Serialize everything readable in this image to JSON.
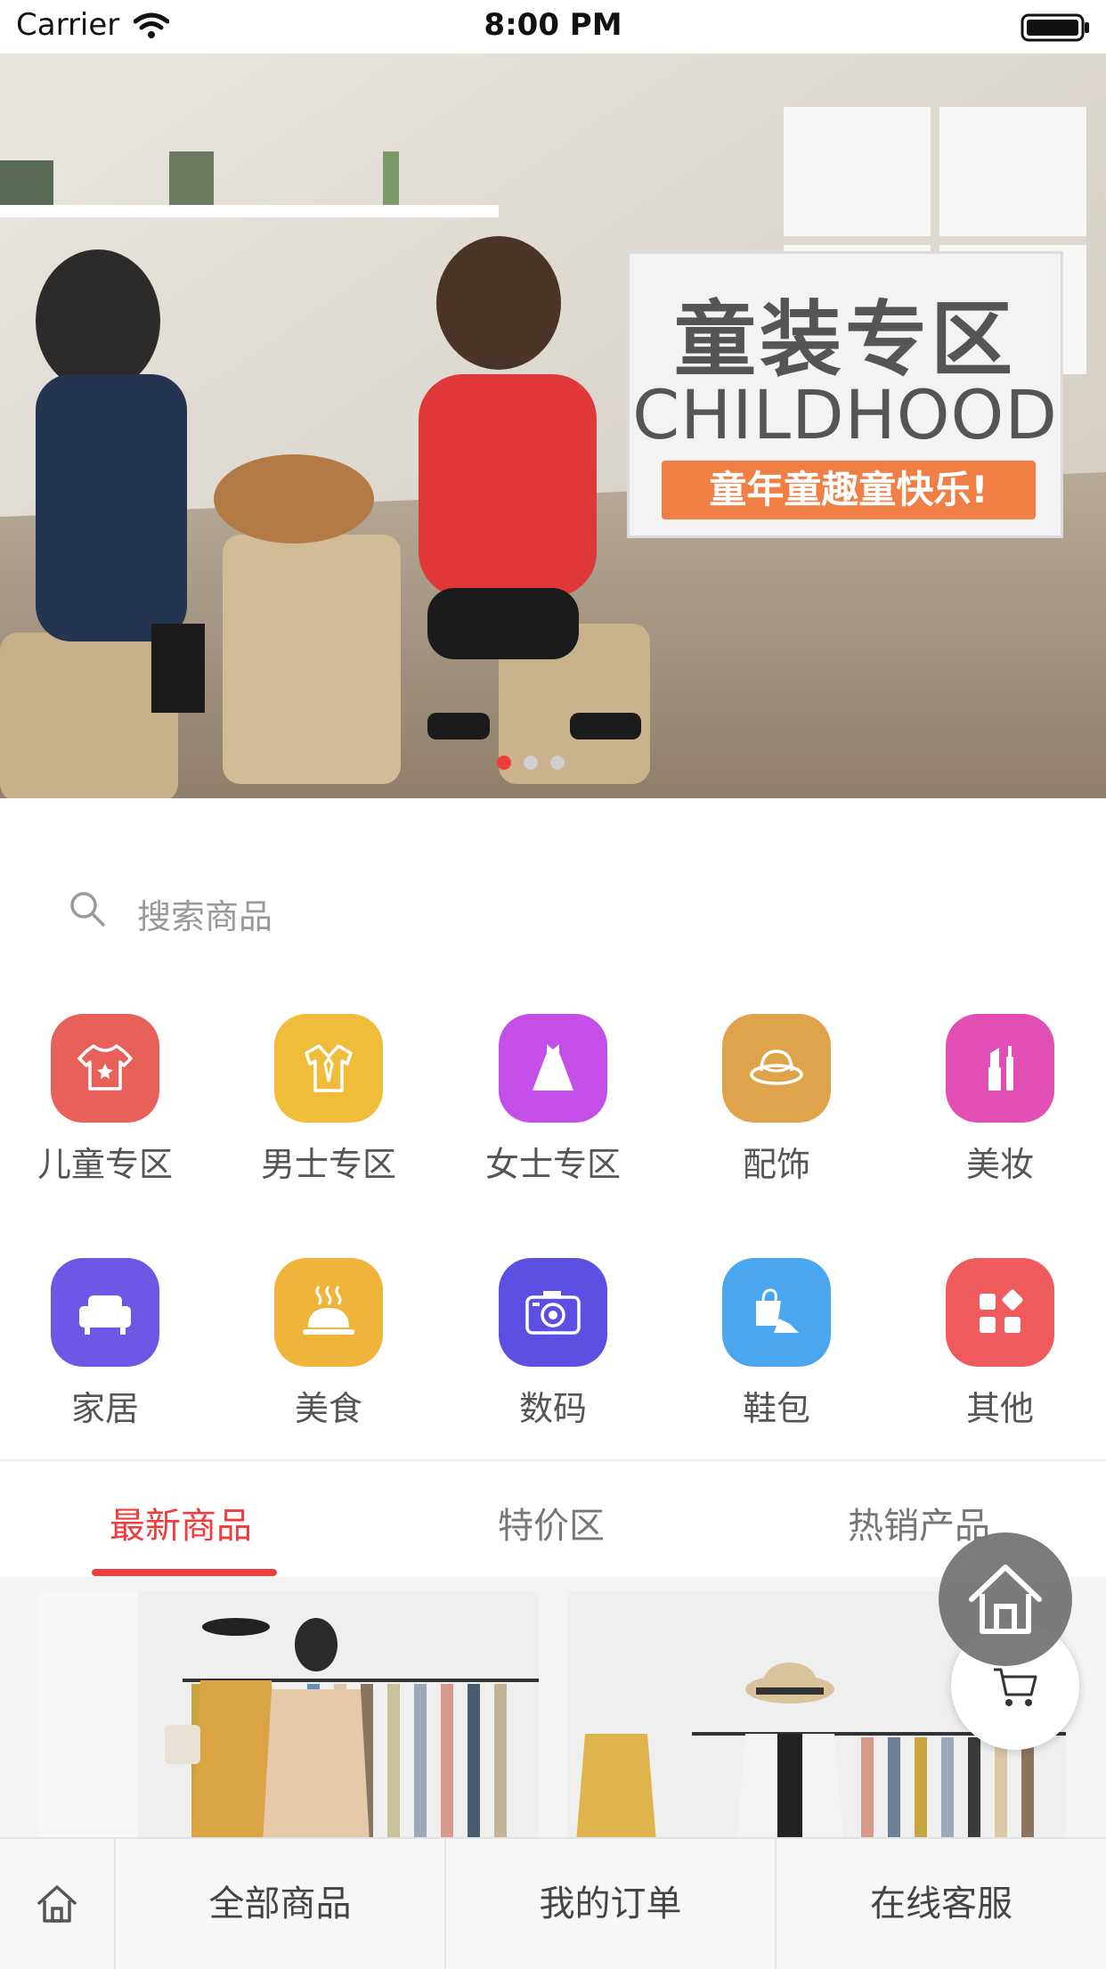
{
  "status_bar": {
    "carrier": "Carrier",
    "time": "8:00 PM"
  },
  "banner": {
    "promo_title": "童装专区",
    "promo_subtitle": "CHILDHOOD",
    "promo_tag": "童年童趣童快乐!",
    "dot_count": 3,
    "active_dot": 0,
    "colors": {
      "dot_active": "#f23c3c",
      "dot_inactive": "#cfcfcf"
    }
  },
  "search": {
    "placeholder": "搜索商品"
  },
  "categories": [
    {
      "label": "儿童专区",
      "icon": "baby-onesie-icon",
      "color": "#e8605a"
    },
    {
      "label": "男士专区",
      "icon": "shirt-tie-icon",
      "color": "#f0bd3a"
    },
    {
      "label": "女士专区",
      "icon": "dress-icon",
      "color": "#c44ee8"
    },
    {
      "label": "配饰",
      "icon": "hat-icon",
      "color": "#dfa34c"
    },
    {
      "label": "美妆",
      "icon": "lipstick-icon",
      "color": "#e24fb4"
    },
    {
      "label": "家居",
      "icon": "sofa-icon",
      "color": "#6f57e6"
    },
    {
      "label": "美食",
      "icon": "food-cloche-icon",
      "color": "#f0b43a"
    },
    {
      "label": "数码",
      "icon": "camera-icon",
      "color": "#5d4fe2"
    },
    {
      "label": "鞋包",
      "icon": "shoe-bag-icon",
      "color": "#4aa6ee"
    },
    {
      "label": "其他",
      "icon": "grid-more-icon",
      "color": "#ee5a5e"
    }
  ],
  "tabs": [
    {
      "label": "最新商品",
      "active": true
    },
    {
      "label": "特价区",
      "active": false
    },
    {
      "label": "热销产品",
      "active": false
    }
  ],
  "bottom_nav": {
    "home_icon": "home-icon",
    "items": [
      "全部商品",
      "我的订单",
      "在线客服"
    ]
  },
  "floating": {
    "home_icon": "home-icon",
    "cart_icon": "cart-icon"
  },
  "colors": {
    "accent": "#f23c3c"
  }
}
